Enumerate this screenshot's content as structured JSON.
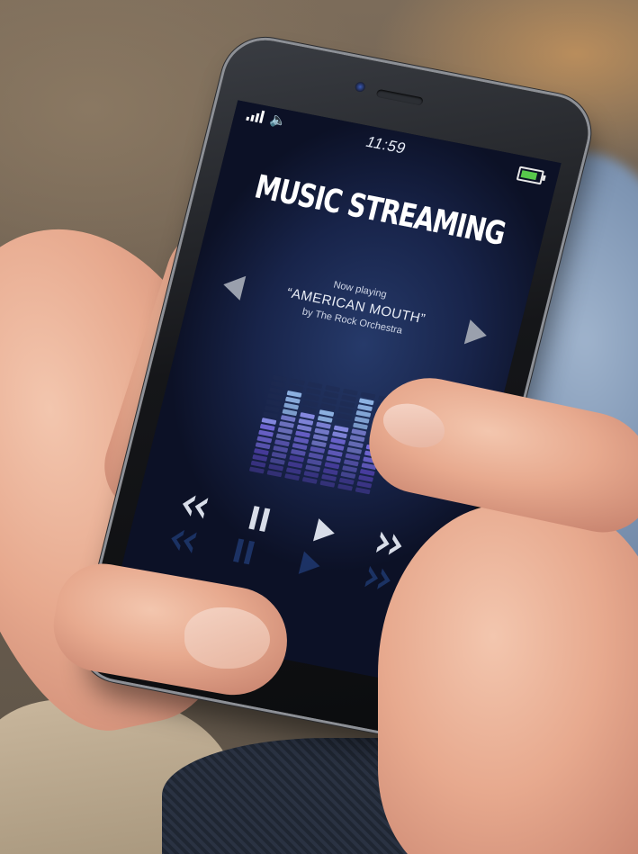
{
  "status_bar": {
    "time": "11:59",
    "battery_color": "#57c84b"
  },
  "app": {
    "title": "MUSIC STREAMING",
    "now_playing": {
      "caption": "Now playing",
      "song": "“AMERICAN MOUTH”",
      "artist": "by The Rock Orchestra"
    }
  },
  "icons": {
    "signal": "signal-icon",
    "volume": "speaker-icon",
    "battery": "battery-icon",
    "previous": "previous-track-icon",
    "next": "next-track-icon",
    "rewind": "rewind-icon",
    "pause": "pause-icon",
    "play": "play-icon",
    "forward": "fast-forward-icon"
  },
  "equalizer": {
    "levels": [
      0.55,
      0.85,
      0.7,
      0.75,
      0.6,
      0.95,
      0.5
    ],
    "colors": [
      "#6a4fd8",
      "#7c6fe6",
      "#8b8ee8",
      "#92b7e8"
    ]
  }
}
